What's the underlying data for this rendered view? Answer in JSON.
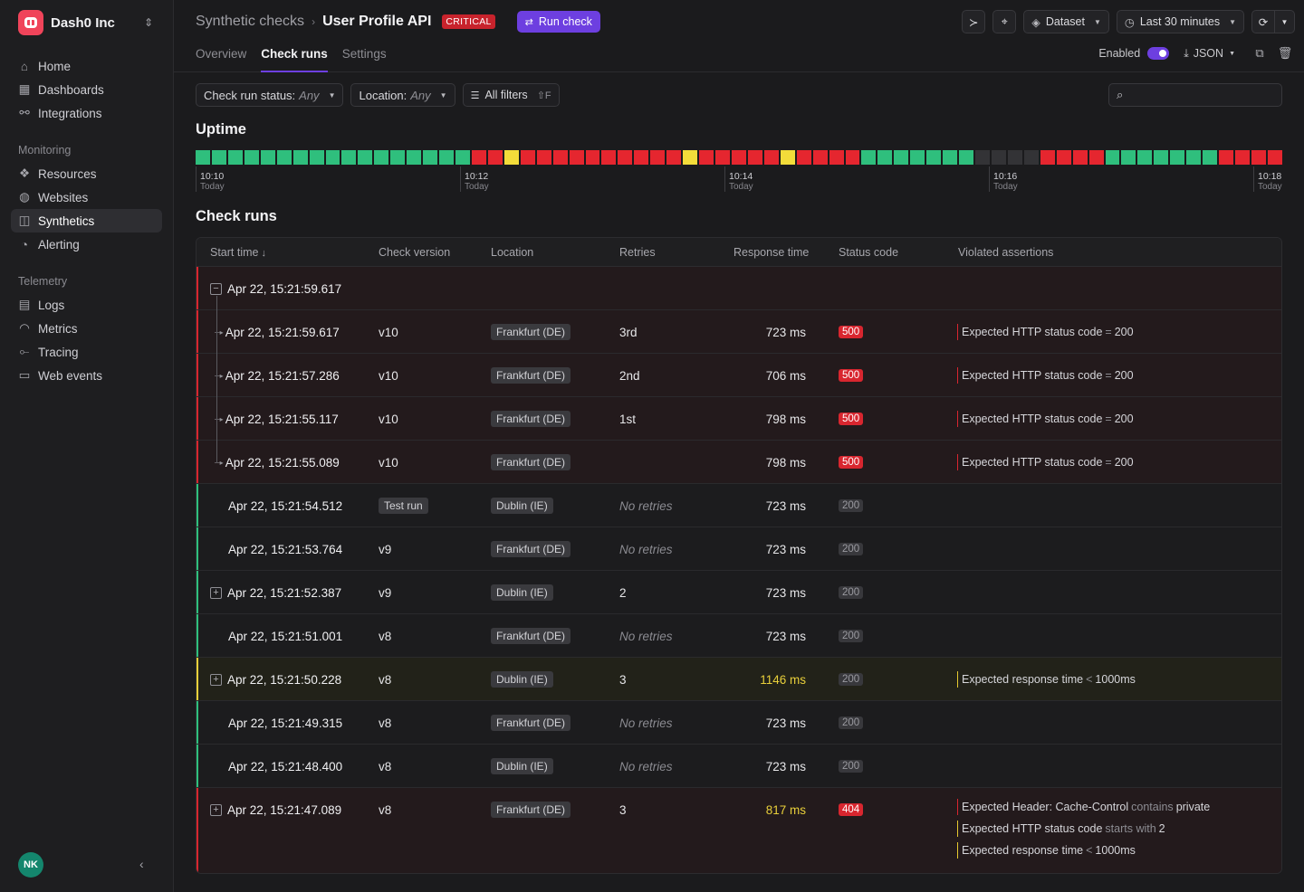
{
  "org": {
    "name": "Dash0 Inc"
  },
  "sidebar": {
    "top": [
      {
        "label": "Home",
        "icon": "home-icon"
      },
      {
        "label": "Dashboards",
        "icon": "dashboards-icon"
      },
      {
        "label": "Integrations",
        "icon": "integrations-icon"
      }
    ],
    "monitoring_label": "Monitoring",
    "monitoring": [
      {
        "label": "Resources",
        "icon": "resources-icon"
      },
      {
        "label": "Websites",
        "icon": "globe-icon"
      },
      {
        "label": "Synthetics",
        "icon": "robot-icon",
        "active": true
      },
      {
        "label": "Alerting",
        "icon": "bell-icon"
      }
    ],
    "telemetry_label": "Telemetry",
    "telemetry": [
      {
        "label": "Logs",
        "icon": "logs-icon"
      },
      {
        "label": "Metrics",
        "icon": "gauge-icon"
      },
      {
        "label": "Tracing",
        "icon": "tracing-icon"
      },
      {
        "label": "Web events",
        "icon": "browser-icon"
      }
    ],
    "user_initials": "NK"
  },
  "header": {
    "crumb_parent": "Synthetic checks",
    "title": "User Profile API",
    "severity": "CRITICAL",
    "run_check": "Run check",
    "dataset": "Dataset",
    "time_range": "Last 30 minutes"
  },
  "tabs": [
    "Overview",
    "Check runs",
    "Settings"
  ],
  "tab_right": {
    "enabled_label": "Enabled",
    "export_label": "JSON"
  },
  "filters": {
    "status_label": "Check run status:",
    "status_value": "Any",
    "location_label": "Location:",
    "location_value": "Any",
    "all_filters": "All filters",
    "shortcut": "⇧F",
    "search_placeholder": ""
  },
  "uptime": {
    "title": "Uptime",
    "colors": {
      "green": "#2fbf7d",
      "red": "#e5262f",
      "yellow": "#f3dc3a",
      "gray": "#333336"
    },
    "bars": [
      "g",
      "g",
      "g",
      "g",
      "g",
      "g",
      "g",
      "g",
      "g",
      "g",
      "g",
      "g",
      "g",
      "g",
      "g",
      "g",
      "g",
      "r",
      "r",
      "y",
      "r",
      "r",
      "r",
      "r",
      "r",
      "r",
      "r",
      "r",
      "r",
      "r",
      "y",
      "r",
      "r",
      "r",
      "r",
      "r",
      "y",
      "r",
      "r",
      "r",
      "r",
      "g",
      "g",
      "g",
      "g",
      "g",
      "g",
      "g",
      "n",
      "n",
      "n",
      "n",
      "r",
      "r",
      "r",
      "r",
      "g",
      "g",
      "g",
      "g",
      "g",
      "g",
      "g",
      "r",
      "r",
      "r",
      "r"
    ],
    "ticks": [
      {
        "time": "10:10",
        "day": "Today"
      },
      {
        "time": "10:12",
        "day": "Today"
      },
      {
        "time": "10:14",
        "day": "Today"
      },
      {
        "time": "10:16",
        "day": "Today"
      },
      {
        "time": "10:18",
        "day": "Today"
      }
    ]
  },
  "runs_title": "Check runs",
  "columns": [
    "Start time",
    "Check version",
    "Location",
    "Retries",
    "Response time",
    "Status code",
    "Violated assertions"
  ],
  "rows": [
    {
      "type": "parent",
      "state": "bad",
      "expand": "−",
      "time": "Apr 22, 15:21:59.617",
      "version": "",
      "location": "",
      "retries": "",
      "retries_muted": false,
      "response": "",
      "resp_color": "",
      "status": "",
      "status_kind": "",
      "violations": []
    },
    {
      "type": "child",
      "state": "bad",
      "time": "Apr 22, 15:21:59.617",
      "version": "v10",
      "location": "Frankfurt (DE)",
      "retries": "3rd",
      "retries_muted": false,
      "response": "723 ms",
      "resp_color": "",
      "status": "500",
      "status_kind": "err",
      "violations": [
        {
          "pre": "Expected HTTP status code",
          "op": "=",
          "post": "200",
          "color": "r"
        }
      ]
    },
    {
      "type": "child",
      "state": "bad",
      "time": "Apr 22, 15:21:57.286",
      "version": "v10",
      "location": "Frankfurt (DE)",
      "retries": "2nd",
      "retries_muted": false,
      "response": "706 ms",
      "resp_color": "",
      "status": "500",
      "status_kind": "err",
      "violations": [
        {
          "pre": "Expected HTTP status code",
          "op": "=",
          "post": "200",
          "color": "r"
        }
      ]
    },
    {
      "type": "child",
      "state": "bad",
      "time": "Apr 22, 15:21:55.117",
      "version": "v10",
      "location": "Frankfurt (DE)",
      "retries": "1st",
      "retries_muted": false,
      "response": "798 ms",
      "resp_color": "",
      "status": "500",
      "status_kind": "err",
      "violations": [
        {
          "pre": "Expected HTTP status code",
          "op": "=",
          "post": "200",
          "color": "r"
        }
      ]
    },
    {
      "type": "child",
      "state": "bad",
      "last": true,
      "time": "Apr 22, 15:21:55.089",
      "version": "v10",
      "location": "Frankfurt (DE)",
      "retries": "",
      "retries_muted": false,
      "response": "798 ms",
      "resp_color": "",
      "status": "500",
      "status_kind": "err",
      "violations": [
        {
          "pre": "Expected HTTP status code",
          "op": "=",
          "post": "200",
          "color": "r"
        }
      ]
    },
    {
      "type": "plain",
      "state": "ok",
      "time": "Apr 22, 15:21:54.512",
      "version": "Test run",
      "version_tag": true,
      "location": "Dublin (IE)",
      "retries": "No retries",
      "retries_muted": true,
      "response": "723 ms",
      "resp_color": "",
      "status": "200",
      "status_kind": "ok",
      "violations": []
    },
    {
      "type": "plain",
      "state": "ok",
      "time": "Apr 22, 15:21:53.764",
      "version": "v9",
      "location": "Frankfurt (DE)",
      "retries": "No retries",
      "retries_muted": true,
      "response": "723 ms",
      "resp_color": "",
      "status": "200",
      "status_kind": "ok",
      "violations": []
    },
    {
      "type": "parent",
      "state": "ok",
      "expand": "+",
      "time": "Apr 22, 15:21:52.387",
      "version": "v9",
      "location": "Dublin (IE)",
      "retries": "2",
      "retries_muted": false,
      "response": "723 ms",
      "resp_color": "",
      "status": "200",
      "status_kind": "ok",
      "violations": []
    },
    {
      "type": "plain",
      "state": "ok",
      "time": "Apr 22, 15:21:51.001",
      "version": "v8",
      "location": "Frankfurt (DE)",
      "retries": "No retries",
      "retries_muted": true,
      "response": "723 ms",
      "resp_color": "",
      "status": "200",
      "status_kind": "ok",
      "violations": []
    },
    {
      "type": "parent",
      "state": "warn",
      "expand": "+",
      "time": "Apr 22, 15:21:50.228",
      "version": "v8",
      "location": "Dublin (IE)",
      "retries": "3",
      "retries_muted": false,
      "response": "1146 ms",
      "resp_color": "#e8cf3a",
      "status": "200",
      "status_kind": "ok",
      "violations": [
        {
          "pre": "Expected response time",
          "op": "<",
          "post": "1000ms",
          "color": "y"
        }
      ]
    },
    {
      "type": "plain",
      "state": "ok",
      "time": "Apr 22, 15:21:49.315",
      "version": "v8",
      "location": "Frankfurt (DE)",
      "retries": "No retries",
      "retries_muted": true,
      "response": "723 ms",
      "resp_color": "",
      "status": "200",
      "status_kind": "ok",
      "violations": []
    },
    {
      "type": "plain",
      "state": "ok",
      "time": "Apr 22, 15:21:48.400",
      "version": "v8",
      "location": "Dublin (IE)",
      "retries": "No retries",
      "retries_muted": true,
      "response": "723 ms",
      "resp_color": "",
      "status": "200",
      "status_kind": "ok",
      "violations": []
    },
    {
      "type": "parent",
      "state": "bad",
      "expand": "+",
      "tall": true,
      "time": "Apr 22, 15:21:47.089",
      "version": "v8",
      "location": "Frankfurt (DE)",
      "retries": "3",
      "retries_muted": false,
      "response": "817 ms",
      "resp_color": "#e8cf3a",
      "status": "404",
      "status_kind": "err",
      "violations": [
        {
          "pre": "Expected Header: Cache-Control",
          "op": "contains",
          "post": "private",
          "color": "r"
        },
        {
          "pre": "Expected HTTP status code",
          "op": "starts with",
          "post": "2",
          "color": "y"
        },
        {
          "pre": "Expected response time",
          "op": "<",
          "post": "1000ms",
          "color": "y"
        }
      ]
    }
  ]
}
